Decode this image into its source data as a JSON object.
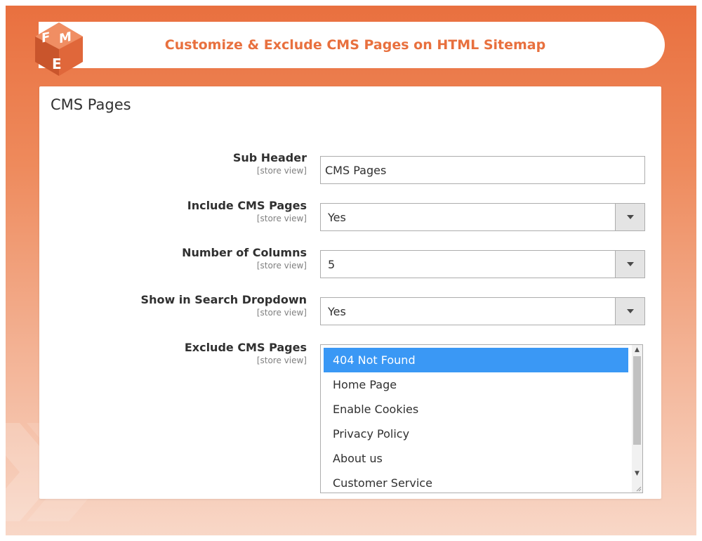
{
  "banner": {
    "title": "Customize & Exclude CMS Pages on HTML Sitemap",
    "logo_icon": "fme-logo-icon",
    "accent": "#e8703e"
  },
  "panel": {
    "title": "CMS Pages",
    "fields": [
      {
        "label": "Sub Header",
        "scope": "[store view]",
        "type": "text",
        "value": "CMS Pages"
      },
      {
        "label": "Include CMS Pages",
        "scope": "[store view]",
        "type": "select",
        "value": "Yes"
      },
      {
        "label": "Number of Columns",
        "scope": "[store view]",
        "type": "select",
        "value": "5"
      },
      {
        "label": "Show in Search Dropdown",
        "scope": "[store view]",
        "type": "select",
        "value": "Yes"
      }
    ],
    "exclude": {
      "label": "Exclude CMS Pages",
      "scope": "[store view]",
      "options": [
        "404 Not Found",
        "Home Page",
        "Enable Cookies",
        "Privacy Policy",
        "About us",
        "Customer Service"
      ],
      "selected": "404 Not Found",
      "selected_color": "#3a98f5"
    }
  },
  "icons": {
    "dropdown": "chevron-down-icon",
    "scroll_up": "scroll-up-arrow-icon",
    "scroll_down": "scroll-down-arrow-icon",
    "resize": "resize-grip-icon"
  }
}
